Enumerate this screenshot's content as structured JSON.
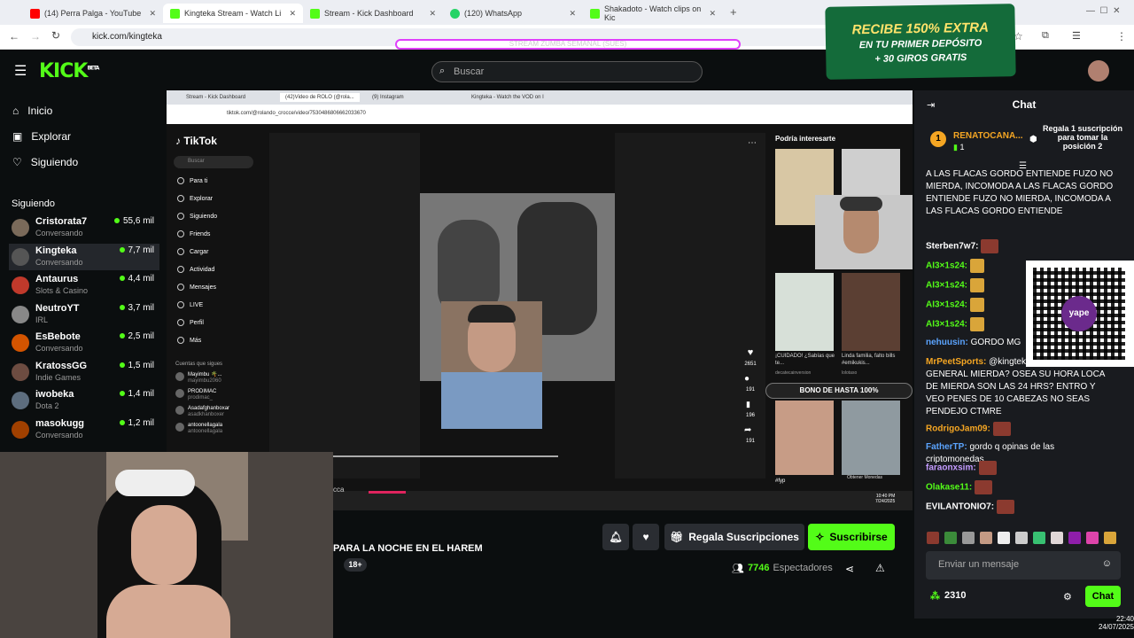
{
  "browser": {
    "tabs": [
      {
        "label": "(14) Perra Palga - YouTube",
        "color": "#ff0000"
      },
      {
        "label": "Kingteka Stream - Watch Li",
        "color": "#53fc18"
      },
      {
        "label": "Stream - Kick Dashboard",
        "color": "#53fc18"
      },
      {
        "label": "(120) WhatsApp",
        "color": "#25d366"
      },
      {
        "label": "Shakadoto - Watch clips on Kic",
        "color": "#53fc18"
      }
    ],
    "url": "kick.com/kingteka"
  },
  "header": {
    "logo": "KICK",
    "logo_sup": "BETA",
    "search_placeholder": "Buscar",
    "overlay_text": "STREAM ZUMBA SEMANAL (SUES)"
  },
  "promo": {
    "line1": "RECIBE 150% EXTRA",
    "line2": "EN TU PRIMER DEPÓSITO",
    "line3": "+ 30 GIROS GRATIS"
  },
  "sidebar": {
    "nav": [
      "Inicio",
      "Explorar",
      "Siguiendo"
    ],
    "following_title": "Siguiendo",
    "channels": [
      {
        "name": "Cristorata7",
        "sub": "Conversando",
        "viewers": "55,6 mil",
        "color": "#7a6a5a"
      },
      {
        "name": "Kingteka",
        "sub": "Conversando",
        "viewers": "7,7 mil",
        "color": "#555"
      },
      {
        "name": "Antaurus",
        "sub": "Slots & Casino",
        "viewers": "4,4 mil",
        "color": "#c0392b"
      },
      {
        "name": "NeutroYT",
        "sub": "IRL",
        "viewers": "3,7 mil",
        "color": "#888"
      },
      {
        "name": "EsBebote",
        "sub": "Conversando",
        "viewers": "2,5 mil",
        "color": "#d35400"
      },
      {
        "name": "KratossGG",
        "sub": "Indie Games",
        "viewers": "1,5 mil",
        "color": "#6d4c41"
      },
      {
        "name": "iwobeka",
        "sub": "Dota 2",
        "viewers": "1,4 mil",
        "color": "#5d6d7e"
      },
      {
        "name": "masokugg",
        "sub": "Conversando",
        "viewers": "1,2 mil",
        "color": "#a04000"
      }
    ]
  },
  "inner": {
    "tabs": [
      "Stream - Kick Dashboard",
      "(42)Video de ROLO (@rola...",
      "(9) Instagram",
      "Kingteka - Watch the VOD on I"
    ],
    "url": "tiktok.com/@rolando_crocce/video/7530486806662033670",
    "tiktok_logo": "TikTok",
    "tiktok_search": "Buscar",
    "tiktok_nav": [
      "Para ti",
      "Explorar",
      "Siguiendo",
      "Friends",
      "Cargar",
      "Actividad",
      "Mensajes",
      "LIVE",
      "Perfil",
      "Más"
    ],
    "following_label": "Cuentas que sigues",
    "accounts": [
      "Mayimbu 🌴...",
      "PRODIMAC",
      "Asadafghanboxar",
      "antoonellagala"
    ],
    "account_subs": [
      "mayimbu2060",
      "prodimac_",
      "asadkhanboxer",
      "antoonellagala"
    ],
    "recommended": "Podría interesarte",
    "bono": "BONO DE HASTA 100%",
    "likes": "2651",
    "comments": "191",
    "saves": "196",
    "shares": "191",
    "rec_captions": [
      "¡CUIDADO! ¿Sabías que te...",
      "Linda familia, falto bills #emikukis..."
    ],
    "rec_users": [
      "decatecainversion",
      "lolotaso"
    ],
    "rec_tags": [
      "#fyp",
      "Obtener Monedas"
    ],
    "taskbar_time": "10:40 PM",
    "taskbar_date": "7/24/2025"
  },
  "stream": {
    "title_fragment": "PARA LA NOCHE EN EL HAREM",
    "age_badge": "18+",
    "gift_button": "Regala Suscripciones",
    "subscribe_button": "Suscribirse",
    "viewers_count": "7746",
    "viewers_label": "Espectadores",
    "cut_text": "cca"
  },
  "chat": {
    "title": "Chat",
    "pinned_user": "RENATOCANA...",
    "pinned_count": "1",
    "pinned_gift": "Regala 1 suscripción para tomar la posición 2",
    "top_text": "A LAS FLACAS GORDO ENTIENDE FUZO NO MIERDA, INCOMODA A LAS FLACAS GORDO ENTIENDE FUZO NO MIERDA, INCOMODA A LAS FLACAS GORDO ENTIENDE",
    "messages": [
      {
        "user": "Sterben7w7:",
        "text": "",
        "color": "#ffffff"
      },
      {
        "user": "AI3×1s24:",
        "text": "",
        "color": "#53fc18"
      },
      {
        "user": "AI3×1s24:",
        "text": "",
        "color": "#53fc18"
      },
      {
        "user": "AI3×1s24:",
        "text": "",
        "color": "#53fc18"
      },
      {
        "user": "AI3×1s24:",
        "text": "",
        "color": "#53fc18"
      },
      {
        "user": "nehuusin:",
        "text": "GORDO MG",
        "color": "#5ba4ff"
      },
      {
        "user": "MrPeetSports:",
        "text": "@kingteka CONTROLAR TU GENERAL MIERDA? OSEA SU HORA LOCA DE MIERDA SON LAS 24 HRS? ENTRO Y VEO PENES DE 10 CABEZAS NO SEAS PENDEJO CTMRE",
        "color": "#f5a623"
      },
      {
        "user": "RodrigoJam09:",
        "text": "",
        "color": "#f5a623"
      },
      {
        "user": "FatherTP:",
        "text": "gordo q opinas de las criptomonedas",
        "color": "#5ba4ff"
      },
      {
        "user": "faraonxsim:",
        "text": "",
        "color": "#c39bff"
      },
      {
        "user": "Olakase11:",
        "text": "",
        "color": "#53fc18"
      },
      {
        "user": "EVILANTONIO7:",
        "text": "",
        "color": "#ffffff"
      }
    ],
    "input_placeholder": "Enviar un mensaje",
    "points": "2310",
    "send_button": "Chat"
  },
  "clock": {
    "time": "22:40",
    "date": "24/07/2025"
  }
}
